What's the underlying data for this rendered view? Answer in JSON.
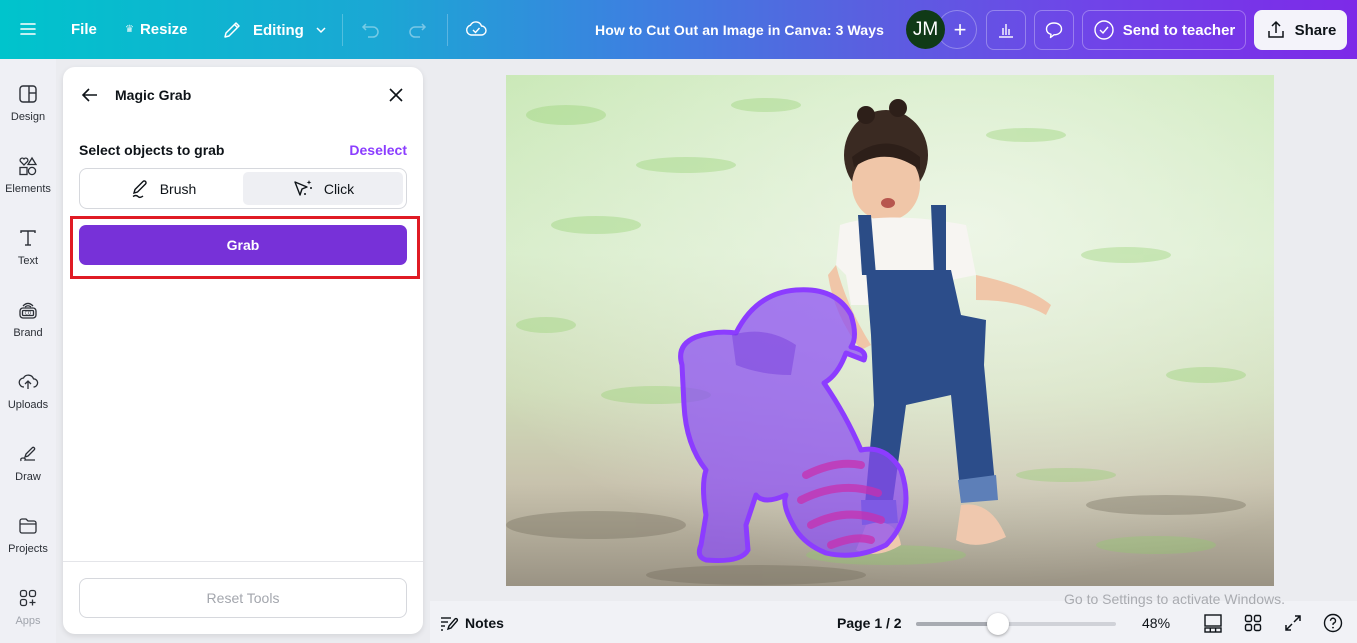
{
  "header": {
    "menu_icon": "hamburger-icon",
    "file_label": "File",
    "resize_label": "Resize",
    "editing_label": "Editing",
    "document_title": "How to Cut Out an Image in Canva: 3 Ways",
    "avatar_initials": "JM",
    "send_label": "Send to teacher",
    "share_label": "Share",
    "gradient_colors": [
      "#00c4cc",
      "#7d2ae8"
    ]
  },
  "sidebar": {
    "items": [
      {
        "label": "Design",
        "icon": "layout-icon"
      },
      {
        "label": "Elements",
        "icon": "shapes-icon"
      },
      {
        "label": "Text",
        "icon": "text-icon"
      },
      {
        "label": "Brand",
        "icon": "brand-icon"
      },
      {
        "label": "Uploads",
        "icon": "cloud-upload-icon"
      },
      {
        "label": "Draw",
        "icon": "pen-icon"
      },
      {
        "label": "Projects",
        "icon": "folder-icon"
      },
      {
        "label": "Apps",
        "icon": "apps-icon"
      }
    ]
  },
  "panel": {
    "title": "Magic Grab",
    "select_label": "Select objects to grab",
    "deselect_label": "Deselect",
    "modes": [
      {
        "label": "Brush",
        "active": false
      },
      {
        "label": "Click",
        "active": true
      }
    ],
    "grab_label": "Grab",
    "reset_label": "Reset Tools",
    "accent_color": "#7731d8",
    "link_color": "#8b3dff",
    "highlight_color": "#e01b24"
  },
  "canvas": {
    "image_description": "Two toddler girls playing with a striped ball on grass; the crouching girl and ball are selected with a purple Magic Grab overlay"
  },
  "footer": {
    "notes_label": "Notes",
    "page_indicator": "Page 1 / 2",
    "zoom_percent": "48%",
    "zoom_slider_fraction": 0.41,
    "watermark": "Go to Settings to activate Windows."
  }
}
